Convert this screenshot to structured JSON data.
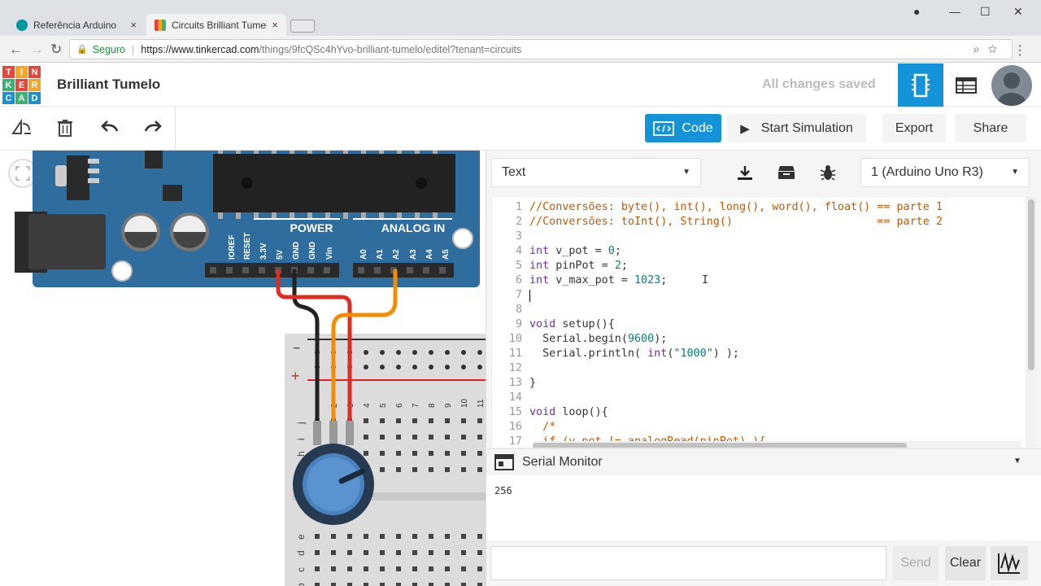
{
  "browser": {
    "tabs": [
      {
        "label": "Referência Arduino",
        "close": "×"
      },
      {
        "label": "Circuits Brilliant Tumelo |",
        "close": "×"
      }
    ],
    "address": {
      "secure_label": "Seguro",
      "url_host": "https://www.tinkercad.com",
      "url_path": "/things/9fcQSc4hYvo-brilliant-tumelo/editel?tenant=circuits"
    }
  },
  "header": {
    "logo_letters": [
      "T",
      "I",
      "N",
      "K",
      "E",
      "R",
      "C",
      "A",
      "D"
    ],
    "project_title": "Brilliant Tumelo",
    "save_status": "All changes saved"
  },
  "toolbar": {
    "code_label": "Code",
    "start_label": "Start Simulation",
    "export_label": "Export",
    "share_label": "Share"
  },
  "breadboard_labels": {
    "power": "POWER",
    "analog_in": "ANALOG IN",
    "power_pins": [
      "IOREF",
      "RESET",
      "3.3V",
      "5V",
      "GND",
      "GND",
      "Vin"
    ],
    "analog_pins": [
      "A0",
      "A1",
      "A2",
      "A3",
      "A4",
      "A5"
    ],
    "rail_minus": "−",
    "rail_plus": "+",
    "col_numbers": [
      "2",
      "3",
      "4",
      "5",
      "6",
      "7",
      "8",
      "9",
      "10",
      "11"
    ],
    "rows_top": [
      "j",
      "i",
      "h"
    ],
    "rows_bottom": [
      "e",
      "d",
      "c",
      "b"
    ]
  },
  "code_panel": {
    "mode": "Text",
    "device": "1 (Arduino Uno R3)",
    "lines": [
      "//Conversões: byte(), int(), long(), word(), float() == parte 1",
      "//Conversões: toInt(), String()                      == parte 2",
      "",
      "int v_pot = 0;",
      "int pinPot = 2;",
      "int v_max_pot = 1023;",
      "",
      "",
      "void setup(){",
      "  Serial.begin(9600);",
      "  Serial.println( int(\"1000\") );",
      "",
      "}",
      "",
      "void loop(){",
      "  /*",
      "  if (v_pot != analogRead(pinPot) ){"
    ]
  },
  "serial_monitor": {
    "title": "Serial Monitor",
    "output": "256",
    "input_value": "",
    "send_label": "Send",
    "clear_label": "Clear"
  },
  "colors": {
    "accent": "#1593d9",
    "arduino_blue": "#2f6d9e",
    "comment": "#c25700",
    "keyword": "#6d2ea8",
    "number": "#0a7a7a"
  }
}
